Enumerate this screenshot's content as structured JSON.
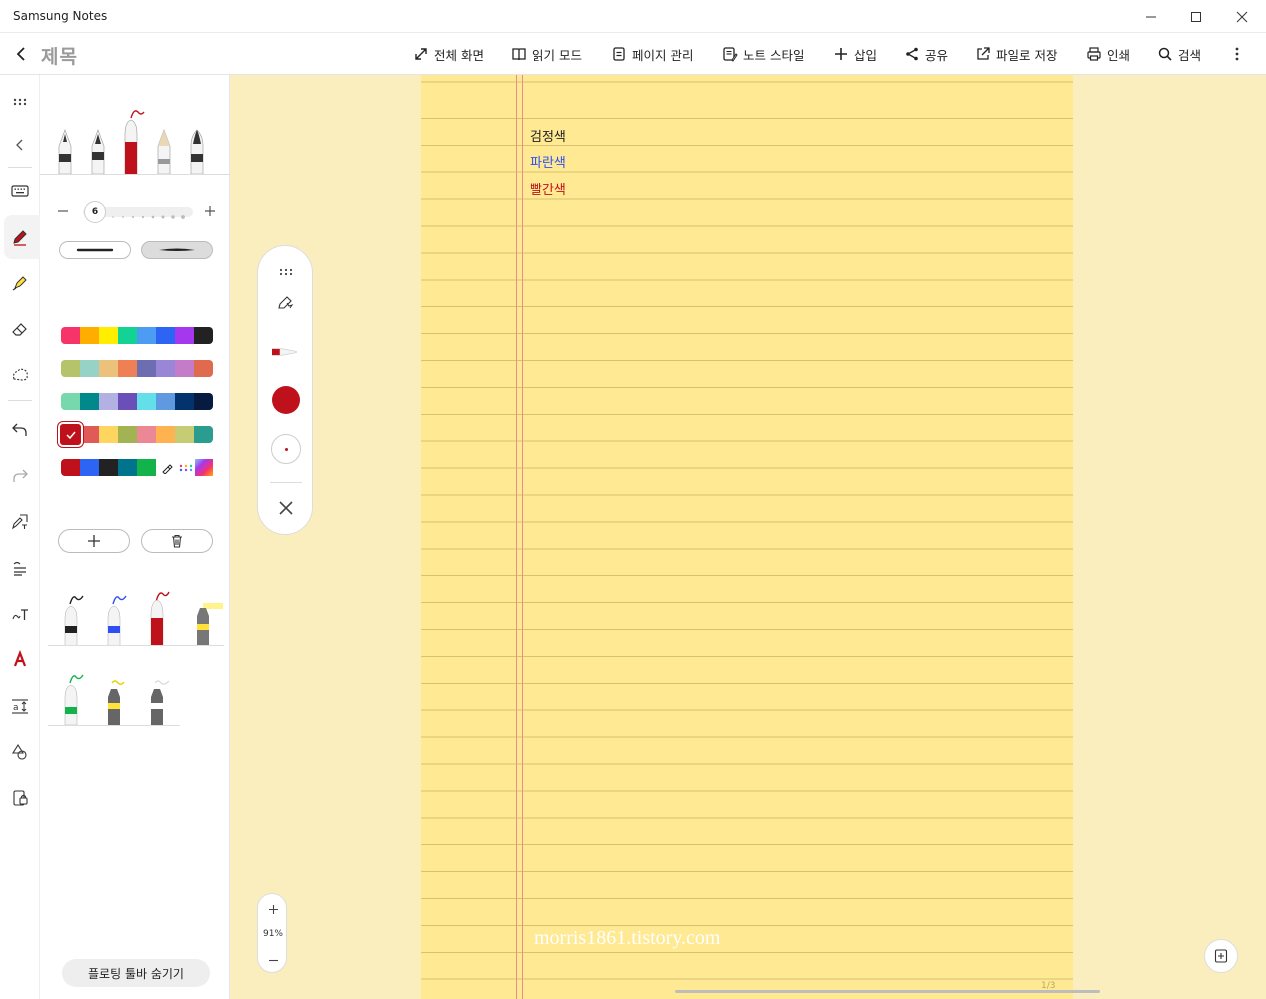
{
  "window": {
    "title": "Samsung Notes",
    "minimize_icon": "minimize-icon",
    "maximize_icon": "maximize-icon",
    "close_icon": "close-icon"
  },
  "header": {
    "note_title": "제목",
    "tools": [
      {
        "label": "전체 화면",
        "icon": "fullscreen-icon"
      },
      {
        "label": "읽기 모드",
        "icon": "book-icon"
      },
      {
        "label": "페이지 관리",
        "icon": "page-icon"
      },
      {
        "label": "노트 스타일",
        "icon": "note-style-icon"
      },
      {
        "label": "삽입",
        "icon": "plus-icon"
      },
      {
        "label": "공유",
        "icon": "share-icon"
      },
      {
        "label": "파일로 저장",
        "icon": "export-icon"
      },
      {
        "label": "인쇄",
        "icon": "print-icon"
      },
      {
        "label": "검색",
        "icon": "search-icon"
      }
    ]
  },
  "pen_panel": {
    "pen_size": "6",
    "selected_color": "#be111b",
    "palette": [
      [
        "#f73469",
        "#ffae00",
        "#ffee00",
        "#12d394",
        "#4d9cf3",
        "#2d64f4",
        "#a538ee",
        "#222222"
      ],
      [
        "#b5c46a",
        "#96d2c5",
        "#ecc17c",
        "#ef7f55",
        "#6d6eb1",
        "#9a86d6",
        "#c57cc8",
        "#e06a4e"
      ],
      [
        "#78d8ad",
        "#00888a",
        "#b3b0e4",
        "#6a4fb8",
        "#63dfe9",
        "#5f9ae1",
        "#03336d",
        "#071b40"
      ],
      [
        "#be111b",
        "#e05a58",
        "#fed55f",
        "#a2b354",
        "#ec8796",
        "#ffb350",
        "#c6cc73",
        "#2a9d8f"
      ],
      [
        "#be111b",
        "#2d64f4",
        "#222222",
        "#00748c",
        "#12b34a",
        "#ffffff",
        "#ffffff",
        "#7ec9f0"
      ]
    ],
    "hide_floating_toolbar": "플로팅 툴바 숨기기"
  },
  "note": {
    "lines": [
      {
        "text": "검정색",
        "color": "#222222"
      },
      {
        "text": "파란색",
        "color": "#2d4ff4"
      },
      {
        "text": "빨간색",
        "color": "#c1121b"
      }
    ],
    "watermark": "morris1861.tistory.com",
    "page_indicator": "1/3"
  },
  "zoom": {
    "value": "91%"
  }
}
